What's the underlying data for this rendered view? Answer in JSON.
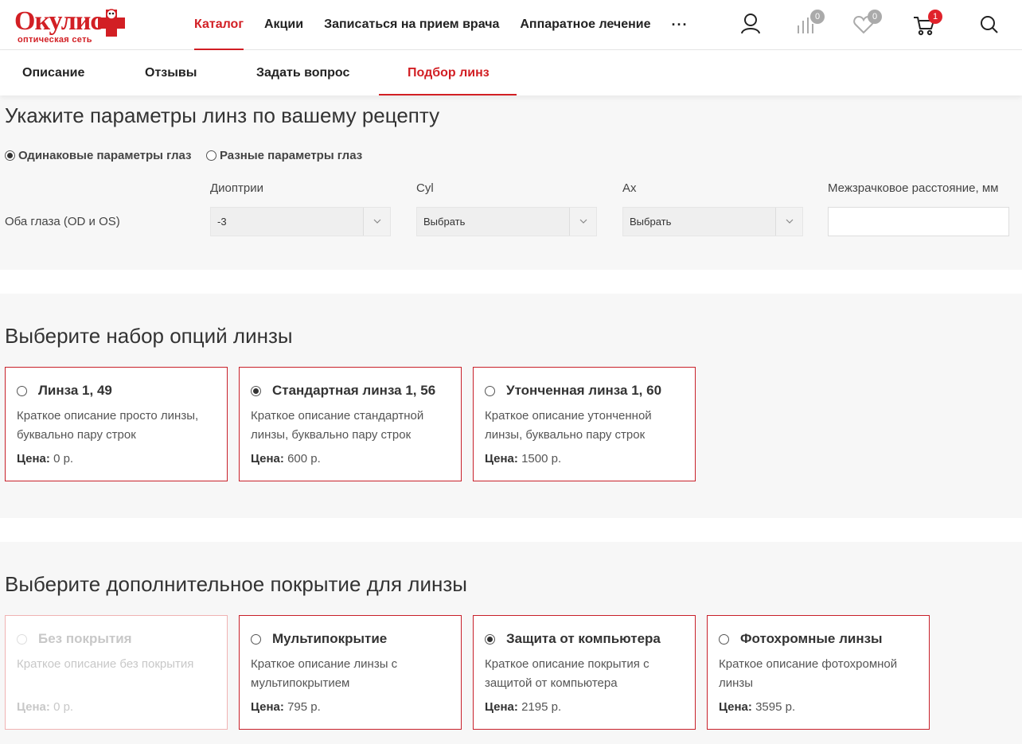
{
  "brand": {
    "logo_text": "Окулис",
    "logo_subtitle": "оптическая сеть",
    "accent": "#d21f24"
  },
  "nav": {
    "items": [
      "Каталог",
      "Акции",
      "Записаться на прием врача",
      "Аппаратное лечение"
    ],
    "active": "Каталог",
    "more_label": "···"
  },
  "header_icons": {
    "account": "user-icon",
    "compare": {
      "icon": "compare-bars-icon",
      "count": "0"
    },
    "favorites": {
      "icon": "heart-icon",
      "count": "0"
    },
    "cart": {
      "icon": "cart-icon",
      "count": "1"
    },
    "search": "search-icon"
  },
  "tabs": {
    "items": [
      "Описание",
      "Отзывы",
      "Задать вопрос",
      "Подбор линз"
    ],
    "active": "Подбор линз"
  },
  "params": {
    "title": "Укажите параметры линз по вашему рецепту",
    "mode_options": [
      "Одинаковые параметры глаз",
      "Разные параметры глаз"
    ],
    "mode_selected": "Одинаковые параметры глаз",
    "columns": [
      "Диоптрии",
      "Cyl",
      "Ax",
      "Межзрачковое расстояние, мм"
    ],
    "row_label": "Оба глаза (OD и OS)",
    "values": {
      "diopters": "-3",
      "cyl": "Выбрать",
      "ax": "Выбрать",
      "pd": ""
    }
  },
  "lens_options": {
    "title": "Выберите набор опций линзы",
    "price_label": "Цена:",
    "cards": [
      {
        "title": "Линза 1, 49",
        "desc": "Краткое описание просто линзы, буквально пару строк",
        "price": "0 р.",
        "selected": false
      },
      {
        "title": "Стандартная линза 1, 56",
        "desc": "Краткое описание стандартной линзы, буквально пару строк",
        "price": "600 р.",
        "selected": true
      },
      {
        "title": "Утонченная линза 1, 60",
        "desc": "Краткое описание утонченной линзы, буквально пару строк",
        "price": "1500 р.",
        "selected": false
      }
    ]
  },
  "coating": {
    "title": "Выберите дополнительное покрытие для линзы",
    "price_label": "Цена:",
    "cards": [
      {
        "title": "Без покрытия",
        "desc": "Краткое описание без покрытия",
        "price": "0 р.",
        "selected": false,
        "disabled": true
      },
      {
        "title": "Мультипокрытие",
        "desc": "Краткое описание линзы с мультипокрытием",
        "price": "795 р.",
        "selected": false
      },
      {
        "title": "Защита от компьютера",
        "desc": "Краткое описание покрытия с защитой от компьютера",
        "price": "2195 р.",
        "selected": true
      },
      {
        "title": "Фотохромные линзы",
        "desc": "Краткое описание фотохромной линзы",
        "price": "3595 р.",
        "selected": false
      }
    ]
  }
}
